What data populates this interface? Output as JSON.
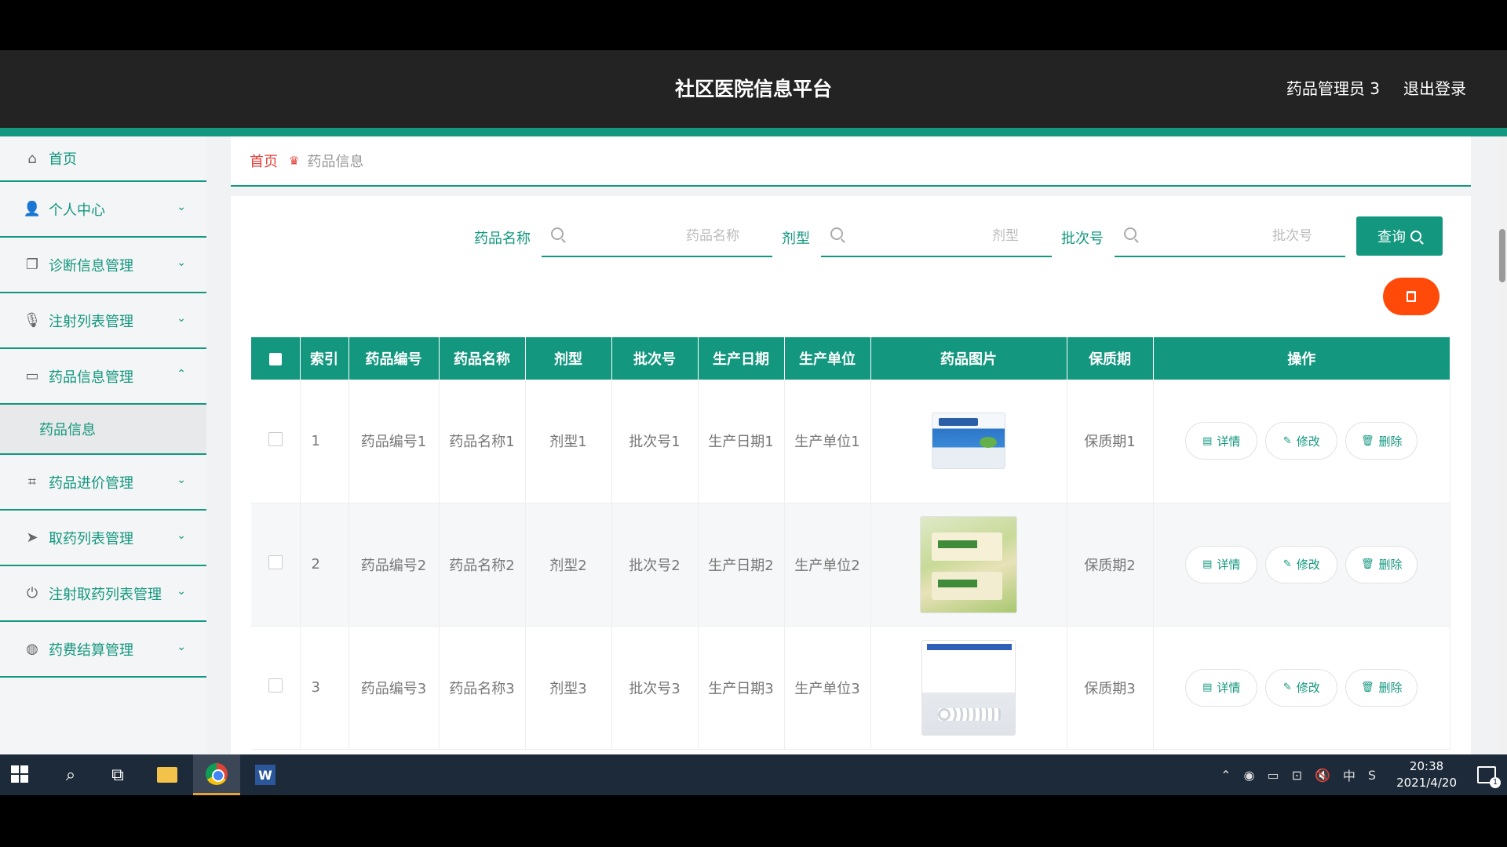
{
  "header": {
    "title": "社区医院信息平台",
    "user": "药品管理员 3",
    "logout": "退出登录"
  },
  "sidebar": {
    "items": [
      {
        "label": "首页",
        "icon": "home-icon"
      },
      {
        "label": "个人中心",
        "icon": "user-icon"
      },
      {
        "label": "诊断信息管理",
        "icon": "copy-icon"
      },
      {
        "label": "注射列表管理",
        "icon": "microphone-icon"
      },
      {
        "label": "药品信息管理",
        "icon": "card-icon",
        "expanded": true
      },
      {
        "label": "药品进价管理",
        "icon": "crop-icon"
      },
      {
        "label": "取药列表管理",
        "icon": "send-icon"
      },
      {
        "label": "注射取药列表管理",
        "icon": "power-icon"
      },
      {
        "label": "药费结算管理",
        "icon": "globe-icon"
      }
    ],
    "sub_item": "药品信息"
  },
  "breadcrumb": {
    "home": "首页",
    "current": "药品信息"
  },
  "search": {
    "name_label": "药品名称",
    "name_placeholder": "药品名称",
    "form_label": "剂型",
    "form_placeholder": "剂型",
    "batch_label": "批次号",
    "batch_placeholder": "批次号",
    "query_button": "查询"
  },
  "table": {
    "headers": [
      "索引",
      "药品编号",
      "药品名称",
      "剂型",
      "批次号",
      "生产日期",
      "生产单位",
      "药品图片",
      "保质期",
      "操作"
    ],
    "rows": [
      {
        "index": "1",
        "code": "药品编号1",
        "name": "药品名称1",
        "form": "剂型1",
        "batch": "批次号1",
        "date": "生产日期1",
        "maker": "生产单位1",
        "shelf": "保质期1"
      },
      {
        "index": "2",
        "code": "药品编号2",
        "name": "药品名称2",
        "form": "剂型2",
        "batch": "批次号2",
        "date": "生产日期2",
        "maker": "生产单位2",
        "shelf": "保质期2"
      },
      {
        "index": "3",
        "code": "药品编号3",
        "name": "药品名称3",
        "form": "剂型3",
        "batch": "批次号3",
        "date": "生产日期3",
        "maker": "生产单位3",
        "shelf": "保质期3"
      }
    ],
    "actions": {
      "detail": "详情",
      "edit": "修改",
      "delete": "删除"
    }
  },
  "taskbar": {
    "time": "20:38",
    "date": "2021/4/20",
    "ime": "中",
    "notifications": "1"
  },
  "colors": {
    "accent": "#13977f",
    "danger": "#ff4a0a",
    "breadcrumb_home": "#e3403a"
  }
}
